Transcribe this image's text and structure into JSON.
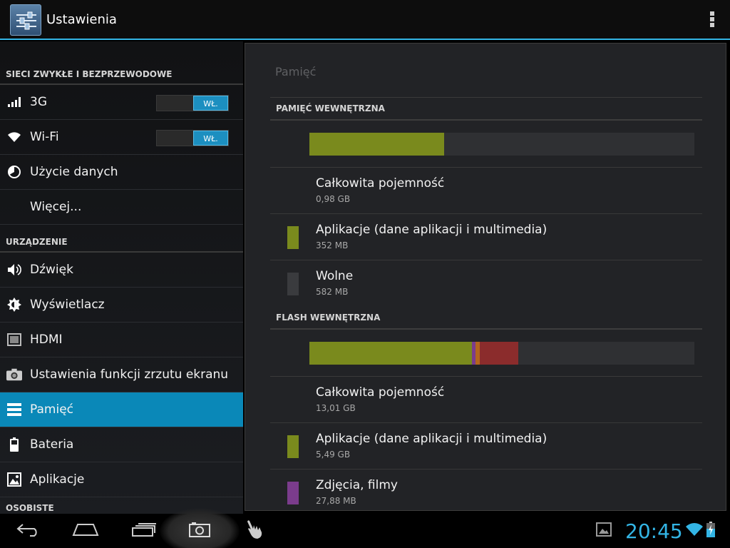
{
  "app": {
    "title": "Ustawienia"
  },
  "sidebar": {
    "sections": [
      {
        "header": "SIECI ZWYKŁE I BEZPRZEWODOWE",
        "items": [
          {
            "label": "3G",
            "icon": "signal-icon",
            "toggle": "WŁ."
          },
          {
            "label": "Wi-Fi",
            "icon": "wifi-icon",
            "toggle": "WŁ."
          },
          {
            "label": "Użycie danych",
            "icon": "data-usage-icon"
          },
          {
            "label": "Więcej...",
            "icon": ""
          }
        ]
      },
      {
        "header": "URZĄDZENIE",
        "items": [
          {
            "label": "Dźwięk",
            "icon": "speaker-icon"
          },
          {
            "label": "Wyświetlacz",
            "icon": "brightness-icon"
          },
          {
            "label": "HDMI",
            "icon": "hdmi-icon"
          },
          {
            "label": "Ustawienia funkcji zrzutu ekranu",
            "icon": "camera-icon"
          },
          {
            "label": "Pamięć",
            "icon": "storage-icon",
            "active": true
          },
          {
            "label": "Bateria",
            "icon": "battery-icon"
          },
          {
            "label": "Aplikacje",
            "icon": "apps-icon"
          }
        ]
      },
      {
        "header": "OSOBISTE",
        "items": []
      }
    ]
  },
  "content": {
    "title": "Pamięć",
    "internal": {
      "header": "PAMIĘĆ WEWNĘTRZNA",
      "usage": [
        {
          "name": "Aplikacje",
          "fraction": 0.35,
          "color": "#7a8a1d"
        }
      ],
      "rows": [
        {
          "title": "Całkowita pojemność",
          "value": "0,98 GB",
          "color": ""
        },
        {
          "title": "Aplikacje (dane aplikacji i multimedia)",
          "value": "352 MB",
          "color": "#7a8a1d"
        },
        {
          "title": "Wolne",
          "value": "582 MB",
          "color": "#3a3b3e"
        }
      ]
    },
    "flash": {
      "header": "FLASH WEWNĘTRZNA",
      "usage": [
        {
          "name": "Aplikacje",
          "fraction": 0.422,
          "color": "#7a8a1d"
        },
        {
          "name": "Zdjęcia, filmy",
          "fraction": 0.01,
          "color": "#7b3c8c"
        },
        {
          "name": "other-a",
          "fraction": 0.01,
          "color": "#b5651d"
        },
        {
          "name": "other-b",
          "fraction": 0.1,
          "color": "#8b2c2c"
        }
      ],
      "rows": [
        {
          "title": "Całkowita pojemność",
          "value": "13,01 GB",
          "color": ""
        },
        {
          "title": "Aplikacje (dane aplikacji i multimedia)",
          "value": "5,49 GB",
          "color": "#7a8a1d"
        },
        {
          "title": "Zdjęcia, filmy",
          "value": "27,88 MB",
          "color": "#7b3c8c"
        }
      ]
    }
  },
  "systembar": {
    "clock": "20:45",
    "accent": "#33b5e5"
  }
}
